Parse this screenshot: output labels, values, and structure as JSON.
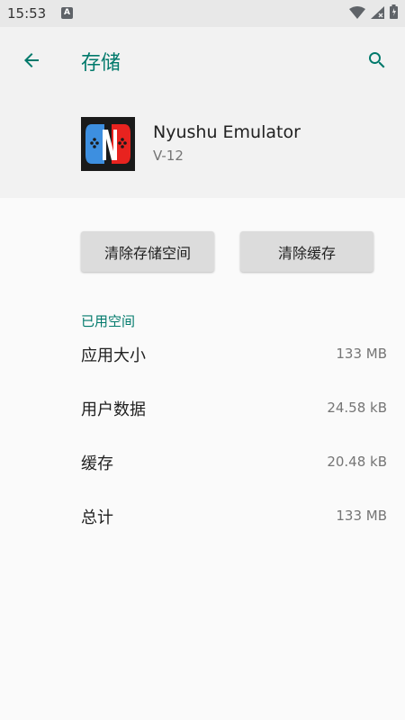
{
  "status_bar": {
    "time": "15:53",
    "notification_letter": "A"
  },
  "header": {
    "title": "存储",
    "back_icon": "arrow-back-icon",
    "search_icon": "search-icon"
  },
  "app": {
    "name": "Nyushu Emulator",
    "version": "V-12",
    "icon_colors": {
      "left": "#3d8fe0",
      "right": "#e8231f",
      "background": "#1a1a1a"
    }
  },
  "buttons": {
    "clear_storage": "清除存储空间",
    "clear_cache": "清除缓存"
  },
  "storage": {
    "section_title": "已用空间",
    "rows": [
      {
        "label": "应用大小",
        "value": "133 MB"
      },
      {
        "label": "用户数据",
        "value": "24.58 kB"
      },
      {
        "label": "缓存",
        "value": "20.48 kB"
      },
      {
        "label": "总计",
        "value": "133 MB"
      }
    ]
  },
  "colors": {
    "accent": "#00796b"
  }
}
